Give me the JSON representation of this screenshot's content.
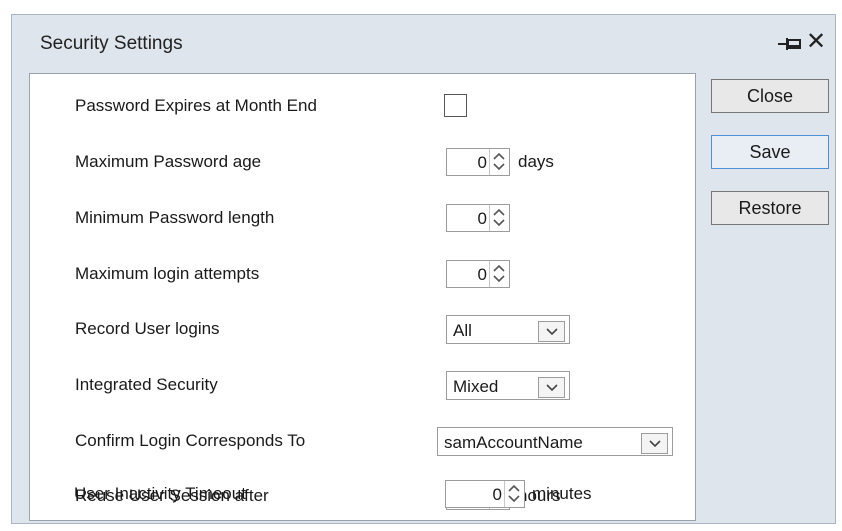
{
  "window": {
    "title": "Security Settings"
  },
  "icons": {
    "pin": "pin-icon",
    "close": "close-icon",
    "spin_up": "chevron-up-icon",
    "spin_down": "chevron-down-icon",
    "dropdown": "chevron-down-icon"
  },
  "buttons": {
    "close": "Close",
    "save": "Save",
    "restore": "Restore"
  },
  "fields": {
    "password_expires": {
      "label": "Password Expires at Month End",
      "checked": false
    },
    "max_password_age": {
      "label": "Maximum Password age",
      "value": "0",
      "unit": "days"
    },
    "min_password_length": {
      "label": "Minimum Password length",
      "value": "0"
    },
    "max_login_attempts": {
      "label": "Maximum login attempts",
      "value": "0"
    },
    "record_user_logins": {
      "label": "Record User logins",
      "value": "All"
    },
    "integrated_security": {
      "label": "Integrated Security",
      "value": "Mixed"
    },
    "confirm_login": {
      "label": "Confirm Login Corresponds To",
      "value": "samAccountName"
    },
    "reuse_session": {
      "label": "Reuse User Session after",
      "value": "0",
      "unit": "hours"
    },
    "inactivity_timeout": {
      "label": "User Inactivity Timeout",
      "value": "0",
      "unit": "minutes"
    }
  },
  "colors": {
    "window_bg": "#dfe5ed",
    "panel_bg": "#ffffff",
    "focus_border": "#4f8fd6"
  }
}
